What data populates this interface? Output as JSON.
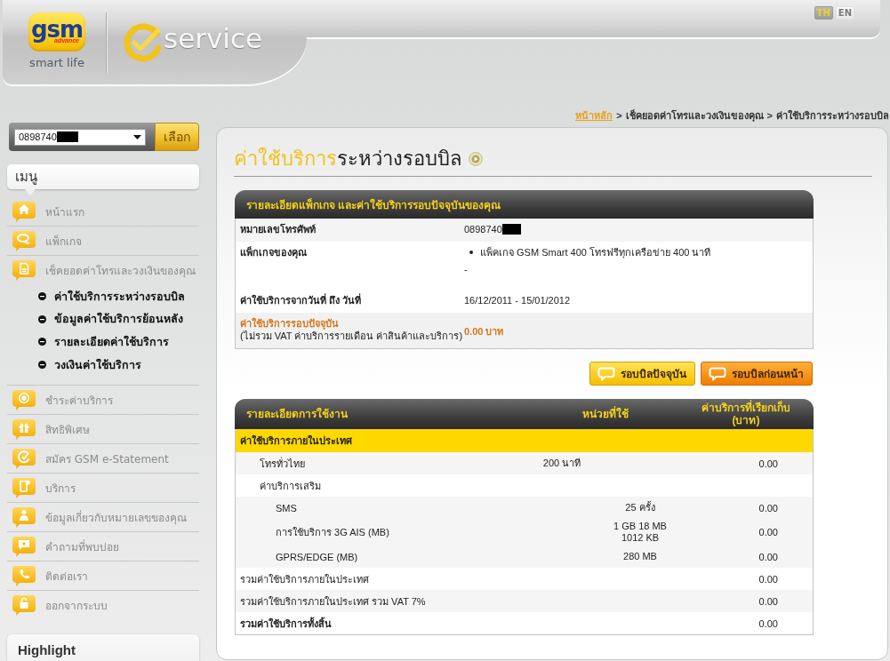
{
  "header": {
    "logo": {
      "wordmark": "gsm",
      "badge": "advance",
      "tagline": "smart life"
    },
    "service_logo": {
      "text": "service"
    },
    "languages": [
      {
        "label": "TH",
        "selected": true
      },
      {
        "label": "EN",
        "selected": false
      }
    ]
  },
  "sidebar": {
    "phone_select": {
      "value": "0898740",
      "redacted": true,
      "button": "เลือก"
    },
    "menu": {
      "title": "เมนู",
      "items": [
        {
          "label": "หน้าแรก"
        },
        {
          "label": "แพ็กเกจ"
        },
        {
          "label": "เช็คยอดค่าโทรและวงเงินของคุณ",
          "children": [
            {
              "label": "ค่าใช้บริการระหว่างรอบบิล"
            },
            {
              "label": "ข้อมูลค่าใช้บริการย้อนหลัง"
            },
            {
              "label": "รายละเอียดค่าใช้บริการ"
            },
            {
              "label": "วงเงินค่าใช้บริการ"
            }
          ]
        },
        {
          "label": "ชำระค่าบริการ"
        },
        {
          "label": "สิทธิพิเศษ"
        },
        {
          "label": "สมัคร GSM e-Statement"
        },
        {
          "label": "บริการ"
        },
        {
          "label": "ข้อมูลเกี่ยวกับหมายเลขของคุณ"
        },
        {
          "label": "คำถามที่พบบ่อย"
        },
        {
          "label": "ติดต่อเรา"
        },
        {
          "label": "ออกจากระบบ"
        }
      ]
    },
    "highlight": {
      "title": "Highlight"
    }
  },
  "breadcrumb": {
    "separator": ">",
    "items": [
      {
        "label": "หน้าหลัก",
        "link": true
      },
      {
        "label": "เช็คยอดค่าโทรและวงเงินของคุณ",
        "link": false
      },
      {
        "label": "ค่าใช้บริการระหว่างรอบบิล",
        "link": false
      }
    ]
  },
  "page_title": {
    "highlight": "ค่าใช้บริการ",
    "rest": "ระหว่างรอบบิล"
  },
  "package_table": {
    "title": "รายละเอียดแพ็กเกจ และค่าใช้บริการรอบปัจจุบันของคุณ",
    "rows": [
      {
        "kind": "phone",
        "label": "หมายเลขโทรศัพท์",
        "value": "0898740",
        "redacted": true
      },
      {
        "kind": "list",
        "label": "แพ็กเกจของคุณ",
        "bullets": [
          "แพ็คเกจ GSM Smart 400 โทรฟรีทุกเครือข่าย 400 นาที"
        ],
        "note": "-"
      },
      {
        "kind": "text",
        "label": "ค่าใช้บริการจากวันที่ ถึง วันที่",
        "value": "16/12/2011 - 15/01/2012"
      },
      {
        "kind": "highlight",
        "label": "ค่าใช้บริการรอบปัจจุบัน",
        "sublabel": "(ไม่รวม VAT ค่าบริการรายเดือน ค่าสินค้าและบริการ)",
        "value": "0.00 บาท"
      }
    ]
  },
  "bill_buttons": [
    {
      "label": "รอบบิลปัจจุบัน",
      "selected": true
    },
    {
      "label": "รอบบิลก่อนหน้า",
      "selected": false
    }
  ],
  "usage_table": {
    "columns": [
      "รายละเอียดการใช้งาน",
      "หน่วยที่ใช้",
      "ค่าบริการที่เรียกเก็บ\n(บาท)"
    ],
    "sections": [
      {
        "title": "ค่าใช้บริการภายในประเทศ",
        "rows": [
          {
            "label": "โทรทั่วไทย",
            "units": "200 นาที",
            "charge": "0.00"
          },
          {
            "label": "ค่าบริการเสริม",
            "children": [
              {
                "label": "SMS",
                "units": "25 ครั้ง",
                "charge": "0.00"
              },
              {
                "label": "การใช้บริการ 3G AIS (MB)",
                "units": "1 GB 18 MB\n1012 KB",
                "charge": "0.00"
              },
              {
                "label": "GPRS/EDGE (MB)",
                "units": "280 MB",
                "charge": "0.00"
              }
            ]
          }
        ]
      }
    ],
    "totals": [
      {
        "kind": "subtotal",
        "label": "รวมค่าใช้บริการภายในประเทศ",
        "charge": "0.00"
      },
      {
        "kind": "subtotal",
        "label": "รวมค่าใช้บริการภายในประเทศ รวม VAT 7%",
        "charge": "0.00"
      },
      {
        "kind": "grand_total",
        "label": "รวมค่าใช้บริการทั้งสิ้น",
        "charge": "0.00"
      }
    ]
  }
}
